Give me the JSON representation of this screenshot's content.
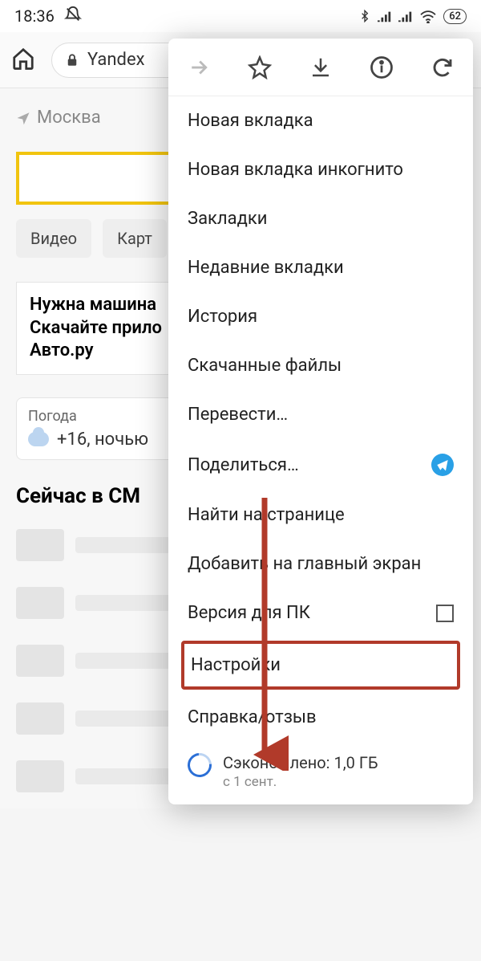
{
  "status": {
    "time": "18:36",
    "battery": "62"
  },
  "toolbar": {
    "url_text": "Yandex"
  },
  "page": {
    "location": "Москва",
    "chip_video": "Видео",
    "chip_images": "Карт",
    "promo_line1": "Нужна машина",
    "promo_line2": "Скачайте прило",
    "promo_line3": "Авто.ру",
    "weather_label": "Погода",
    "weather_text": "+16, ночью",
    "news_heading": "Сейчас в СМ"
  },
  "menu": {
    "items": [
      "Новая вкладка",
      "Новая вкладка инкогнито",
      "Закладки",
      "Недавние вкладки",
      "История",
      "Скачанные файлы",
      "Перевести…",
      "Поделиться…",
      "Найти на странице",
      "Добавить на главный экран",
      "Версия для ПК",
      "Настройки",
      "Справка/отзыв"
    ],
    "saved_title": "Сэкономлено: 1,0 ГБ",
    "saved_sub": "с 1 сент."
  }
}
